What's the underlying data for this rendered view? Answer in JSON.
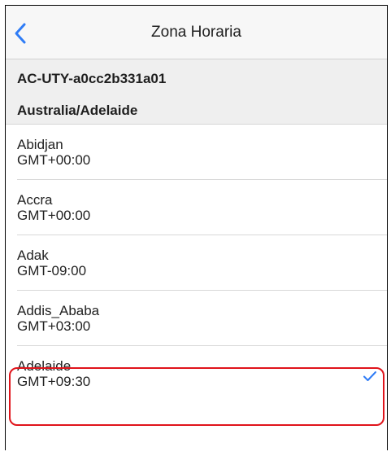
{
  "navbar": {
    "title": "Zona Horaria",
    "back_icon": "chevron-left-icon"
  },
  "device": {
    "id": "AC-UTY-a0cc2b331a01",
    "current_zone": "Australia/Adelaide"
  },
  "timezones": [
    {
      "name": "Abidjan",
      "offset": "GMT+00:00",
      "selected": false
    },
    {
      "name": "Accra",
      "offset": "GMT+00:00",
      "selected": false
    },
    {
      "name": "Adak",
      "offset": "GMT-09:00",
      "selected": false
    },
    {
      "name": "Addis_Ababa",
      "offset": "GMT+03:00",
      "selected": false
    },
    {
      "name": "Adelaide",
      "offset": "GMT+09:30",
      "selected": true
    }
  ],
  "colors": {
    "accent": "#2f7cf6",
    "highlight": "#e0141b"
  },
  "icons": {
    "selected": "checkmark-icon"
  }
}
